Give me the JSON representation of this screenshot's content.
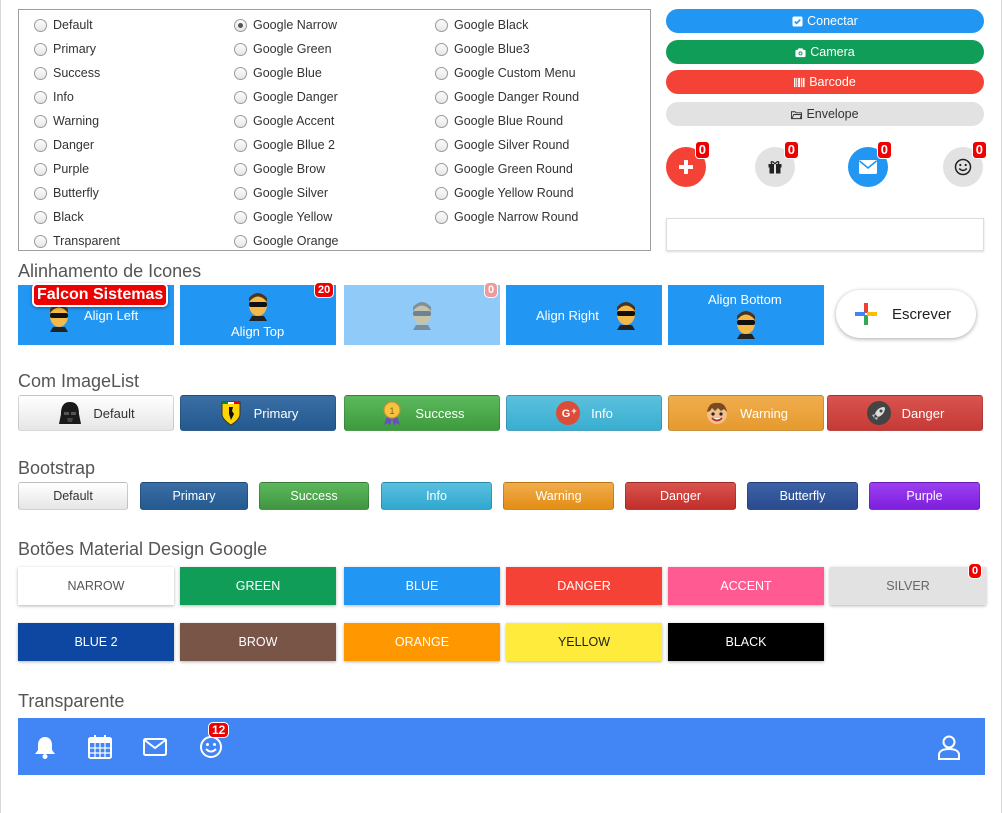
{
  "radio_group": {
    "col1": [
      "Default",
      "Primary",
      "Success",
      "Info",
      "Warning",
      "Danger",
      "Purple",
      "Butterfly",
      "Black",
      "Transparent"
    ],
    "col2": [
      "Google Narrow",
      "Google Green",
      "Google Blue",
      "Google Danger",
      "Google Accent",
      "Google Bllue 2",
      "Google Brow",
      "Google Silver",
      "Google Yellow",
      "Google Orange"
    ],
    "col3": [
      "Google Black",
      "Google Blue3",
      "Google Custom Menu",
      "Google Danger Round",
      "Google Blue Round",
      "Google Silver Round",
      "Google Green Round",
      "Google Yellow Round",
      "Google Narrow Round"
    ],
    "selected": "Google Narrow"
  },
  "top_buttons": {
    "connect": "Conectar",
    "camera": "Camera",
    "barcode": "Barcode",
    "envelope": "Envelope"
  },
  "circle_badges": [
    "0",
    "0",
    "0",
    "0"
  ],
  "sections": {
    "icons": "Alinhamento de Icones",
    "imagelist": "Com ImageList",
    "bootstrap": "Bootstrap",
    "material": "Botões Material Design Google",
    "transparent": "Transparente"
  },
  "align_buttons": {
    "left": "Align Left",
    "top": "Align Top",
    "right": "Align Right",
    "bottom": "Align Bottom",
    "hint": "Falcon Sistemas",
    "badge_top": "20",
    "badge_disabled": "0",
    "write": "Escrever"
  },
  "imagelist_buttons": [
    "Default",
    "Primary",
    "Success",
    "Info",
    "Warning",
    "Danger"
  ],
  "bootstrap_buttons": [
    "Default",
    "Primary",
    "Success",
    "Info",
    "Warning",
    "Danger",
    "Butterfly",
    "Purple"
  ],
  "material_row1": [
    "NARROW",
    "GREEN",
    "BLUE",
    "DANGER",
    "ACCENT",
    "SILVER"
  ],
  "material_row2": [
    "BLUE 2",
    "BROW",
    "ORANGE",
    "YELLOW",
    "BLACK"
  ],
  "material_badge": "0",
  "toolbar_badge": "12",
  "colors": {
    "blue": "#2196f3",
    "green": "#0f9d58",
    "red": "#f44336",
    "toolbar": "#4285f4"
  }
}
